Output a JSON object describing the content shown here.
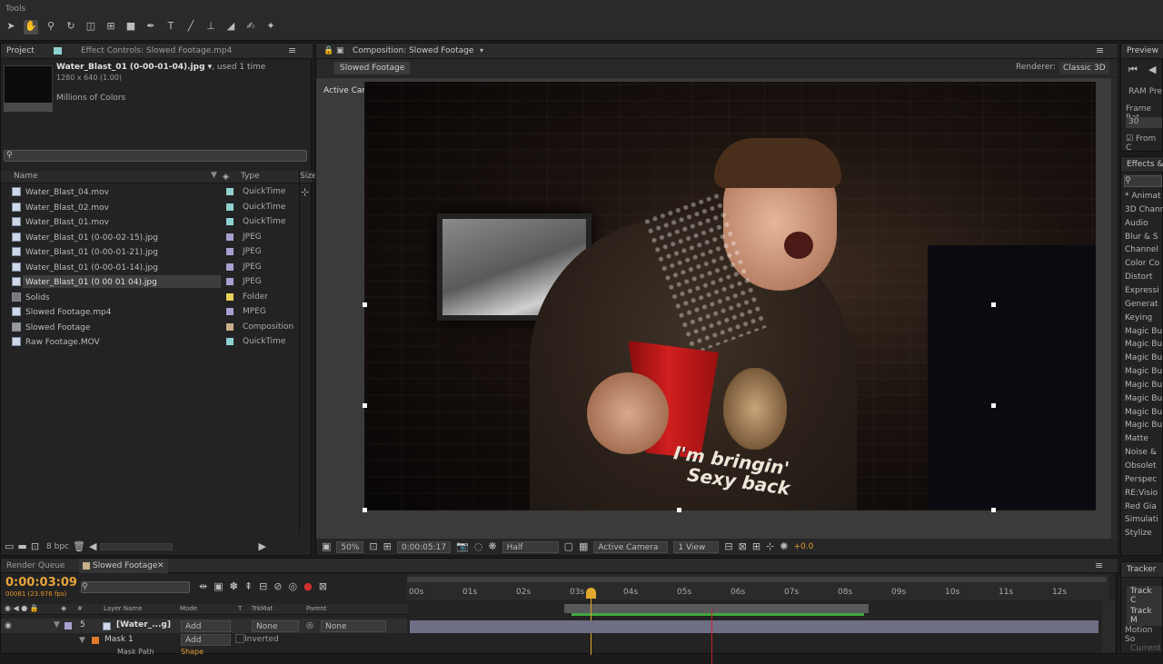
{
  "tools_panel": {
    "title": "Tools",
    "tools": [
      "selection-tool-icon",
      "hand-tool-icon",
      "zoom-tool-icon",
      "rotate-tool-icon",
      "camera-orbit-icon",
      "pan-behind-icon",
      "rectangle-tool-icon",
      "pen-tool-icon",
      "type-tool-icon",
      "brush-tool-icon",
      "clone-stamp-icon",
      "eraser-icon",
      "roto-brush-icon",
      "puppet-pin-icon"
    ]
  },
  "project_panel": {
    "tab_project": "Project",
    "tab_effect_controls": "Effect Controls: Slowed Footage.mp4",
    "selected_name": "Water_Blast_01 (0-00-01-04).jpg ▾",
    "used_text": ", used 1 time",
    "dimensions": "1280 x 640 (1.00)",
    "colors": "Millions of Colors",
    "columns": {
      "name": "Name",
      "type": "Type",
      "size": "Size"
    },
    "items": [
      {
        "name": "Water_Blast_04.mov",
        "type": "QuickTime",
        "swatch": "#8fd0d0"
      },
      {
        "name": "Water_Blast_02.mov",
        "type": "QuickTime",
        "swatch": "#8fd0d0"
      },
      {
        "name": "Water_Blast_01.mov",
        "type": "QuickTime",
        "swatch": "#8fd0d0"
      },
      {
        "name": "Water_Blast_01 (0-00-02-15).jpg",
        "type": "JPEG",
        "swatch": "#a9a0d0"
      },
      {
        "name": "Water_Blast_01 (0-00-01-21).jpg",
        "type": "JPEG",
        "swatch": "#a9a0d0"
      },
      {
        "name": "Water_Blast_01 (0-00-01-14).jpg",
        "type": "JPEG",
        "swatch": "#a9a0d0"
      },
      {
        "name": "Water_Blast_01 (0 00 01 04).jpg",
        "type": "JPEG",
        "swatch": "#a9a0d0"
      },
      {
        "name": "Solids",
        "type": "Folder",
        "swatch": "#e6d35a"
      },
      {
        "name": "Slowed Footage.mp4",
        "type": "MPEG",
        "swatch": "#a9a0d0"
      },
      {
        "name": "Slowed Footage",
        "type": "Composition",
        "swatch": "#c7b08a"
      },
      {
        "name": "Raw Footage.MOV",
        "type": "QuickTime",
        "swatch": "#8fd0d0"
      }
    ],
    "bpc": "8 bpc"
  },
  "composition_panel": {
    "tab": "Composition: Slowed Footage",
    "subtab": "Slowed Footage",
    "renderer_label": "Renderer:",
    "renderer_value": "Classic 3D",
    "active_camera_label": "Active Camera",
    "shirt_text_1": "I'm bringin'",
    "shirt_text_2": "Sexy back",
    "zoom": "50%",
    "timecode": "0:00:05:17",
    "resolution": "Half",
    "view": "Active Camera",
    "views": "1 View",
    "exposure": "+0.0"
  },
  "preview_panel": {
    "title": "Preview",
    "ram_preview": "RAM Pre",
    "frame_rate_label": "Frame Rat",
    "frame_rate": "30",
    "from_current": "From C"
  },
  "effects_panel": {
    "title": "Effects &",
    "items": [
      "* Animat",
      "3D Chann",
      "Audio",
      "Blur & S",
      "Channel",
      "Color Co",
      "Distort",
      "Expressi",
      "Generat",
      "Keying",
      "Magic Bu",
      "Magic Bu",
      "Magic Bu",
      "Magic Bu",
      "Magic Bu",
      "Magic Bu",
      "Magic Bu",
      "Magic Bu",
      "Matte",
      "Noise &",
      "Obsolet",
      "Perspec",
      "RE:Visio",
      "Red Gia",
      "Simulati",
      "Stylize"
    ]
  },
  "tracker_panel": {
    "title": "Tracker",
    "track_camera": "Track C",
    "track_motion": "Track M",
    "motion_source": "Motion So",
    "current": "Current"
  },
  "timeline": {
    "tab_render_queue": "Render Queue",
    "tab_comp": "Slowed Footage",
    "timecode": "0:00:03:09",
    "frames": "00081 (23.976 fps)",
    "col_layer": "Layer Name",
    "col_mode": "Mode",
    "col_t": "T",
    "col_trkmat": "TrkMat",
    "col_parent": "Parent",
    "ticks": [
      "00s",
      "01s",
      "02s",
      "03s",
      "04s",
      "05s",
      "06s",
      "07s",
      "08s",
      "09s",
      "10s",
      "11s",
      "12s"
    ],
    "layer": {
      "number": "5",
      "name": "[Water_...g]",
      "mode": "Add",
      "trkmat": "None",
      "parent": "None"
    },
    "mask": {
      "name": "Mask 1",
      "mode": "Add",
      "inverted": "Inverted"
    },
    "mask_path": "Mask Path",
    "mask_path_value": "Shape"
  }
}
